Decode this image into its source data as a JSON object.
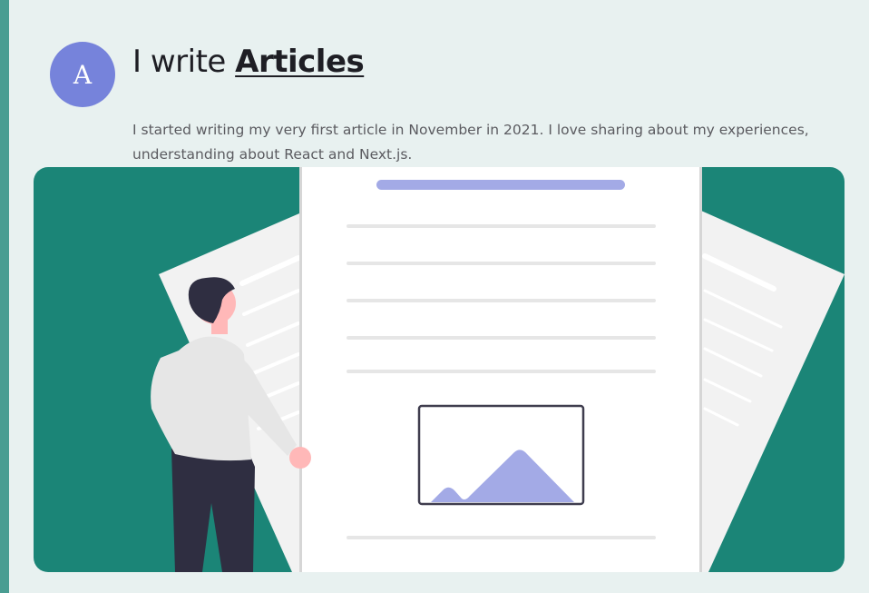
{
  "header": {
    "avatar_letter": "A",
    "title_prefix": "I write",
    "title_keyword": "Articles",
    "description": "I started writing my very first article in November in 2021. I love sharing about my experiences, understanding about React and Next.js."
  },
  "illustration": {
    "subject": "person-presenting-article-document",
    "colors": {
      "background": "#1b8577",
      "accent": "#a3aae6",
      "paper": "#ffffff",
      "paper_back": "#f2f2f2",
      "line": "#e6e6e6",
      "dark": "#2f2e41",
      "skin": "#ffb8b8"
    }
  },
  "theme": {
    "card_background": "#e8f1f0",
    "accent_bar": "#4a9d92",
    "avatar_color": "#7683db",
    "text_dark": "#1e1e24",
    "text_muted": "#5b5b60"
  }
}
